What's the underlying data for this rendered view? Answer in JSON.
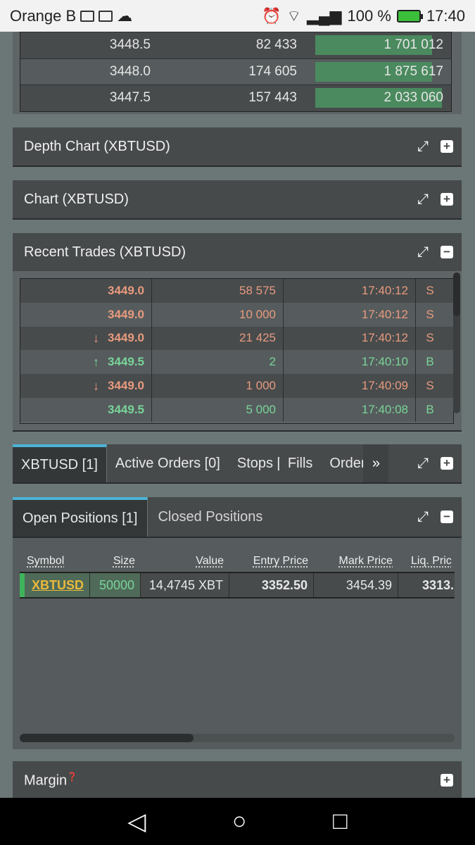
{
  "status_bar": {
    "carrier": "Orange B",
    "battery": "100 %",
    "time": "17:40"
  },
  "orderbook": {
    "rows": [
      {
        "price": "3448.5",
        "size": "82 433",
        "total": "1 701 012",
        "depth": 0.89
      },
      {
        "price": "3448.0",
        "size": "174 605",
        "total": "1 875 617",
        "depth": 0.89
      },
      {
        "price": "3447.5",
        "size": "157 443",
        "total": "2 033 060",
        "depth": 0.97
      }
    ]
  },
  "panels": {
    "depth_chart": "Depth Chart (XBTUSD)",
    "chart": "Chart (XBTUSD)",
    "recent_trades": "Recent Trades (XBTUSD)",
    "margin": "Margin"
  },
  "recent_trades": [
    {
      "price": "3449.0",
      "size": "58 575",
      "time": "17:40:12",
      "side": "S",
      "arrow": ""
    },
    {
      "price": "3449.0",
      "size": "10 000",
      "time": "17:40:12",
      "side": "S",
      "arrow": ""
    },
    {
      "price": "3449.0",
      "size": "21 425",
      "time": "17:40:12",
      "side": "S",
      "arrow": "↓"
    },
    {
      "price": "3449.5",
      "size": "2",
      "time": "17:40:10",
      "side": "B",
      "arrow": "↑"
    },
    {
      "price": "3449.0",
      "size": "1 000",
      "time": "17:40:09",
      "side": "S",
      "arrow": "↓"
    },
    {
      "price": "3449.5",
      "size": "5 000",
      "time": "17:40:08",
      "side": "B",
      "arrow": ""
    }
  ],
  "tabs": {
    "items": [
      "XBTUSD [1]",
      "Active Orders [0]",
      "Stops [",
      "Fills",
      "Order Hi"
    ],
    "more": "»"
  },
  "positions": {
    "tabs": [
      "Open Positions [1]",
      "Closed Positions"
    ],
    "columns": [
      "Symbol",
      "Size",
      "Value",
      "Entry Price",
      "Mark Price",
      "Liq. Pric"
    ],
    "row": {
      "symbol": "XBTUSD",
      "size": "50000",
      "value": "14,4745 XBT",
      "entry_price": "3352.50",
      "mark_price": "3454.39",
      "liq_price": "3313."
    },
    "scroll_position": 0.4
  },
  "icons": {
    "expand": "expand-icon",
    "add": "plus-icon",
    "collapse": "minus-icon",
    "help": "help-icon"
  },
  "colors": {
    "sell": "#e89a7e",
    "buy": "#79d49a",
    "accent": "#4ab3d6",
    "symbol_link": "#e9b93c"
  }
}
